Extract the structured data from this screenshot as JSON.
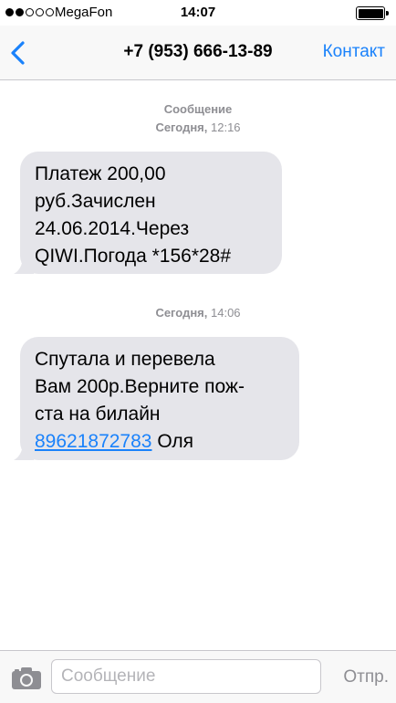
{
  "status_bar": {
    "signal_bars_filled": 2,
    "signal_bars_total": 5,
    "carrier": "MegaFon",
    "time": "14:07",
    "battery_level": 1.0
  },
  "nav": {
    "back_icon": "chevron-left-icon",
    "title": "+7 (953) 666-13-89",
    "contact_label": "Контакт"
  },
  "thread": {
    "header_label": "Сообщение",
    "header_day": "Сегодня,",
    "header_time": "12:16",
    "messages": [
      {
        "day": "Сегодня,",
        "time": "",
        "text": "Платеж 200,00\nруб.Зачислен\n24.06.2014.Через\nQIWI.Погода *156*28#"
      },
      {
        "day": "Сегодня,",
        "time": "14:06",
        "text": "Спутала и перевела\nВам 200р.Верните пож-\nста на билайн\n",
        "link": "89621872783",
        "suffix": " Оля"
      }
    ]
  },
  "input_bar": {
    "camera_icon": "camera-icon",
    "placeholder": "Сообщение",
    "value": "",
    "send_label": "Отпр."
  },
  "colors": {
    "accent": "#1a82fb",
    "bubble": "#e5e5ea",
    "meta": "#8e8e93"
  }
}
